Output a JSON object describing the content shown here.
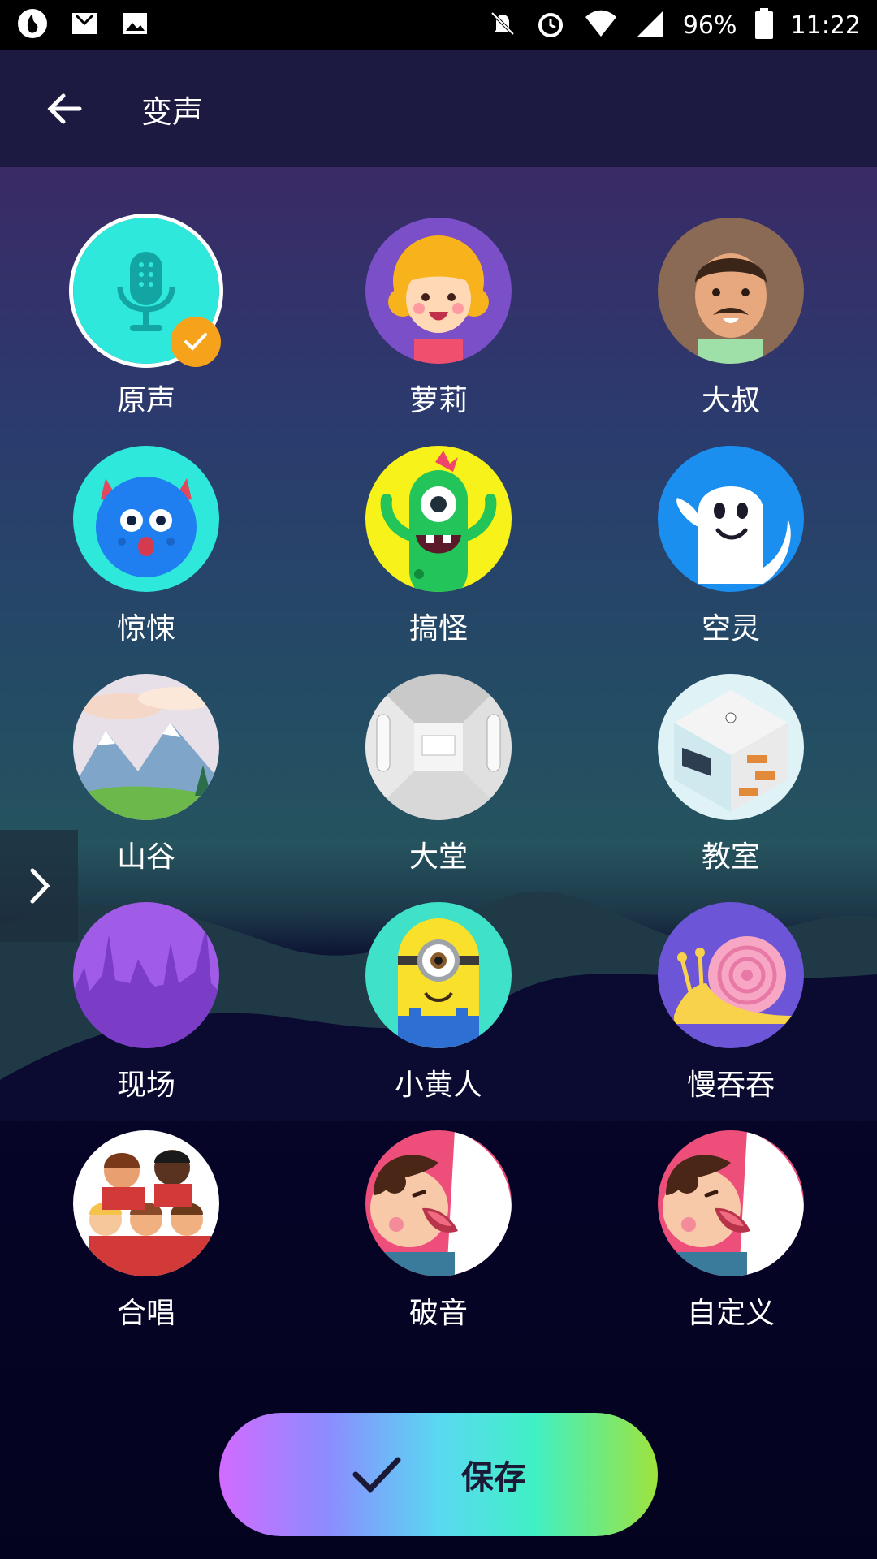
{
  "status_bar": {
    "battery": "96%",
    "time": "11:22",
    "icons": [
      "app-logo-icon",
      "mail-icon",
      "image-icon",
      "notifications-off-icon",
      "alarm-icon",
      "wifi-icon",
      "signal-icon",
      "battery-icon"
    ]
  },
  "header": {
    "title": "变声",
    "back_icon": "arrow-left-icon"
  },
  "voices": [
    {
      "label": "原声",
      "icon": "microphone-icon",
      "selected": true
    },
    {
      "label": "萝莉",
      "icon": "girl-avatar-icon"
    },
    {
      "label": "大叔",
      "icon": "uncle-avatar-icon"
    },
    {
      "label": "惊悚",
      "icon": "blue-monster-icon"
    },
    {
      "label": "搞怪",
      "icon": "green-monster-icon"
    },
    {
      "label": "空灵",
      "icon": "ghost-icon"
    },
    {
      "label": "山谷",
      "icon": "valley-image-icon"
    },
    {
      "label": "大堂",
      "icon": "hall-image-icon"
    },
    {
      "label": "教室",
      "icon": "classroom-image-icon"
    },
    {
      "label": "现场",
      "icon": "concert-crowd-icon"
    },
    {
      "label": "小黄人",
      "icon": "minion-icon"
    },
    {
      "label": "慢吞吞",
      "icon": "snail-icon"
    },
    {
      "label": "合唱",
      "icon": "choir-icon"
    },
    {
      "label": "破音",
      "icon": "shouting-man-icon"
    },
    {
      "label": "自定义",
      "icon": "shouting-man-icon"
    }
  ],
  "side_tab_icon": "chevron-right-icon",
  "save_button": {
    "label": "保存",
    "icon": "check-icon"
  },
  "colors": {
    "badge": "#f7a21b",
    "header_bg": "#1d1a42"
  }
}
